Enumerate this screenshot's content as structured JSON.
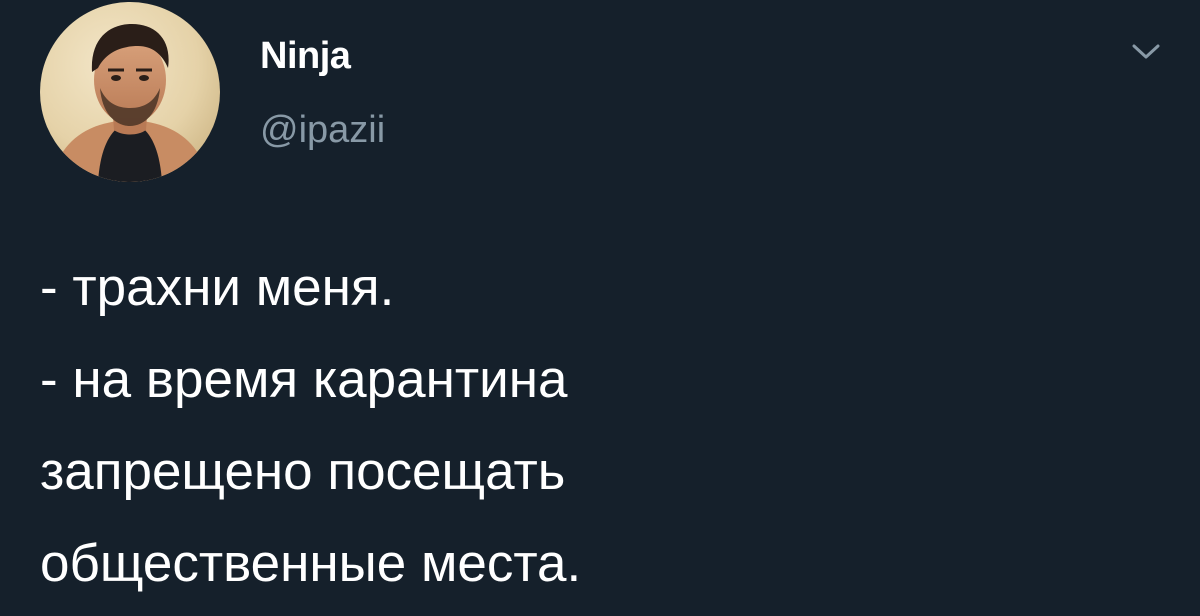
{
  "user": {
    "display_name": "Ninja",
    "handle": "@ipazii"
  },
  "icons": {
    "avatar": "user-avatar-photo",
    "menu": "chevron-down-icon"
  },
  "tweet": {
    "lines": [
      "- трахни меня.",
      "- на время карантина",
      "запрещено посещать",
      "общественные места."
    ]
  },
  "colors": {
    "background": "#15202b",
    "text": "#ffffff",
    "secondary_text": "#8899a6"
  }
}
